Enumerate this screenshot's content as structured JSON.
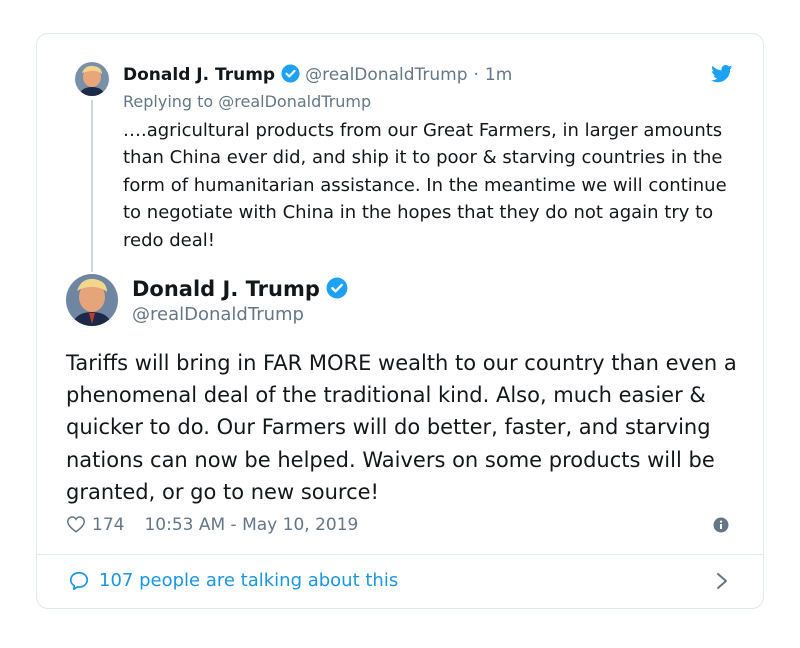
{
  "colors": {
    "link": "#1b95e0",
    "secondary_text": "#657786",
    "verified": "#1da1f2",
    "border": "#e1e8ed"
  },
  "icons": [
    "twitter-bird-icon",
    "verified-icon",
    "heart-icon",
    "info-icon",
    "speech-bubble-icon",
    "chevron-right-icon"
  ],
  "parent_tweet": {
    "name": "Donald J. Trump",
    "handle": "@realDonaldTrump",
    "separator": "·",
    "time": "1m",
    "replying_to": "Replying to @realDonaldTrump",
    "text": "….agricultural products from our Great Farmers, in larger amounts than China ever did, and ship it to poor & starving countries in the form of humanitarian assistance. In the meantime we will continue to negotiate with China in the hopes that they do not again try to redo deal!"
  },
  "main_tweet": {
    "name": "Donald J. Trump",
    "handle": "@realDonaldTrump",
    "text": "Tariffs will bring in FAR MORE wealth to our country than even a phenomenal deal of the traditional kind. Also, much easier & quicker to do. Our Farmers will do better, faster, and starving nations can now be helped. Waivers on some products will be granted, or go to new source!",
    "likes": "174",
    "timestamp": "10:53 AM - May 10, 2019"
  },
  "footer": {
    "talking_text": "107 people are talking about this"
  }
}
